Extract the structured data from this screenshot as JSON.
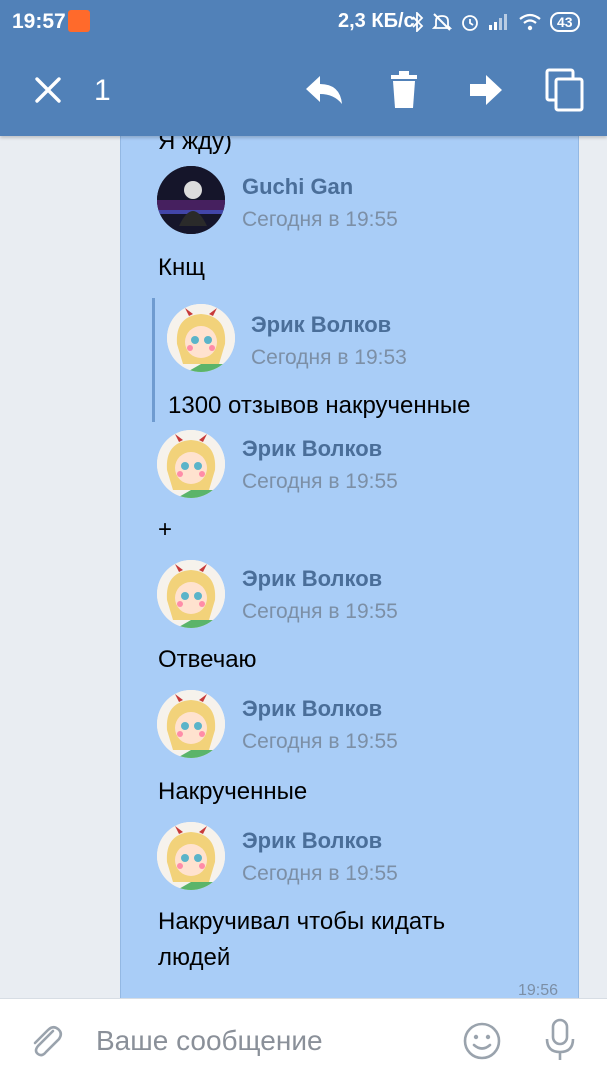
{
  "status_bar": {
    "time": "19:57",
    "speed": "2,3 КБ/с",
    "battery": "43",
    "icons": [
      "app-notification-icon",
      "bluetooth-icon",
      "mute-icon",
      "alarm-icon",
      "signal-icon",
      "wifi-icon",
      "battery-icon"
    ]
  },
  "action_bar": {
    "selected_count": "1",
    "icons": [
      "close-icon",
      "reply-icon",
      "trash-icon",
      "forward-icon",
      "copy-icon"
    ]
  },
  "conversation": {
    "cut_text": "Я жду)",
    "messages": [
      {
        "author": "Guchi Gan",
        "date": "Сегодня в 19:55",
        "text": "Кнщ"
      },
      {
        "author": "Эрик Волков",
        "date": "Сегодня в 19:53",
        "text": "1300 отзывов накрученные",
        "quoted": true
      },
      {
        "author": "Эрик Волков",
        "date": "Сегодня в 19:55",
        "text": "+"
      },
      {
        "author": "Эрик Волков",
        "date": "Сегодня в 19:55",
        "text": "Отвечаю"
      },
      {
        "author": "Эрик Волков",
        "date": "Сегодня в 19:55",
        "text": "Накрученные"
      },
      {
        "author": "Эрик Волков",
        "date": "Сегодня в 19:55",
        "text_line1": "Накручивал чтобы кидать",
        "text_line2": "людей"
      }
    ],
    "sent_time": "19:56"
  },
  "input": {
    "placeholder": "Ваше сообщение",
    "icons": [
      "attach-icon",
      "emoji-icon",
      "microphone-icon"
    ]
  },
  "colors": {
    "header_blue": "#5181b8",
    "selected_bg": "#a9cdf7",
    "author_text": "#4a6e99",
    "date_text": "#7c8fa6"
  }
}
